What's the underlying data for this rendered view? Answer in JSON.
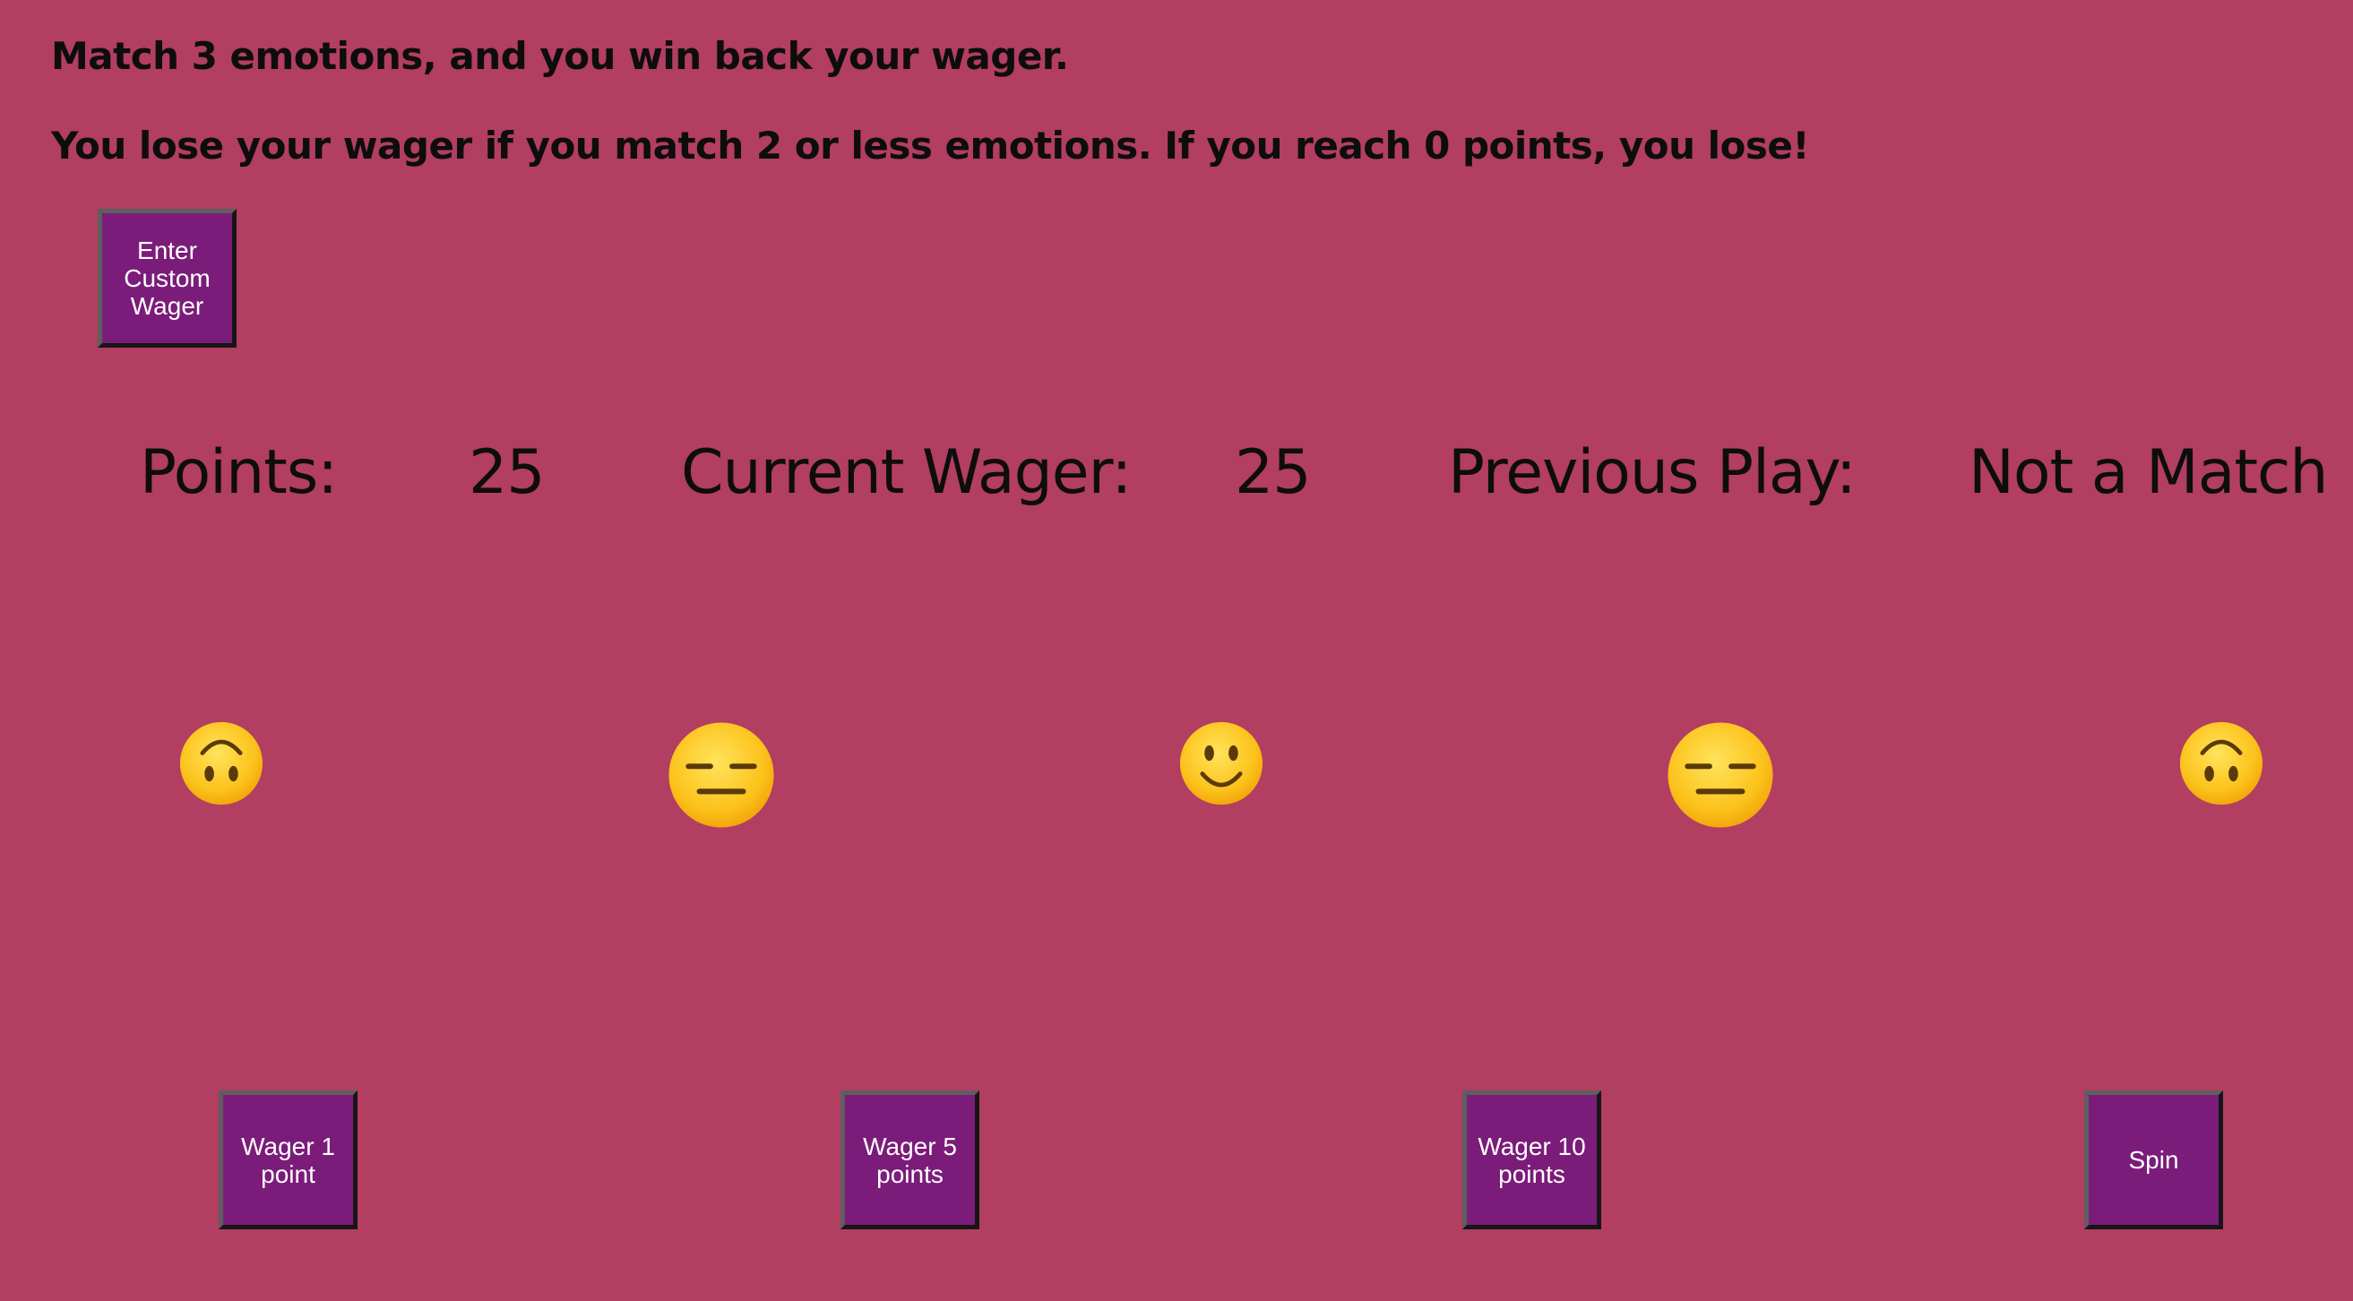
{
  "rules": {
    "line1": "Match 3 emotions, and you win back your wager.",
    "line2": "You lose your wager if you match 2 or less emotions. If you reach 0 points, you lose!"
  },
  "buttons": {
    "custom_wager": "Enter Custom Wager",
    "wager_1": "Wager 1 point",
    "wager_5": "Wager 5 points",
    "wager_10": "Wager 10 points",
    "spin": "Spin"
  },
  "stats": {
    "points_label": "Points:",
    "points_value": "25",
    "wager_label": "Current Wager:",
    "wager_value": "25",
    "previous_label": "Previous Play:",
    "previous_value": "Not a Match"
  },
  "reels": [
    {
      "icon": "upside-down-face-icon"
    },
    {
      "icon": "expressionless-face-icon"
    },
    {
      "icon": "slightly-smiling-face-icon"
    },
    {
      "icon": "expressionless-face-icon"
    },
    {
      "icon": "upside-down-face-icon"
    }
  ],
  "colors": {
    "background": "#b23e61",
    "button": "#7b1c7a",
    "button_text": "#ffffff",
    "text": "#0d0d0d",
    "emoji_face": "#fbc02d"
  }
}
